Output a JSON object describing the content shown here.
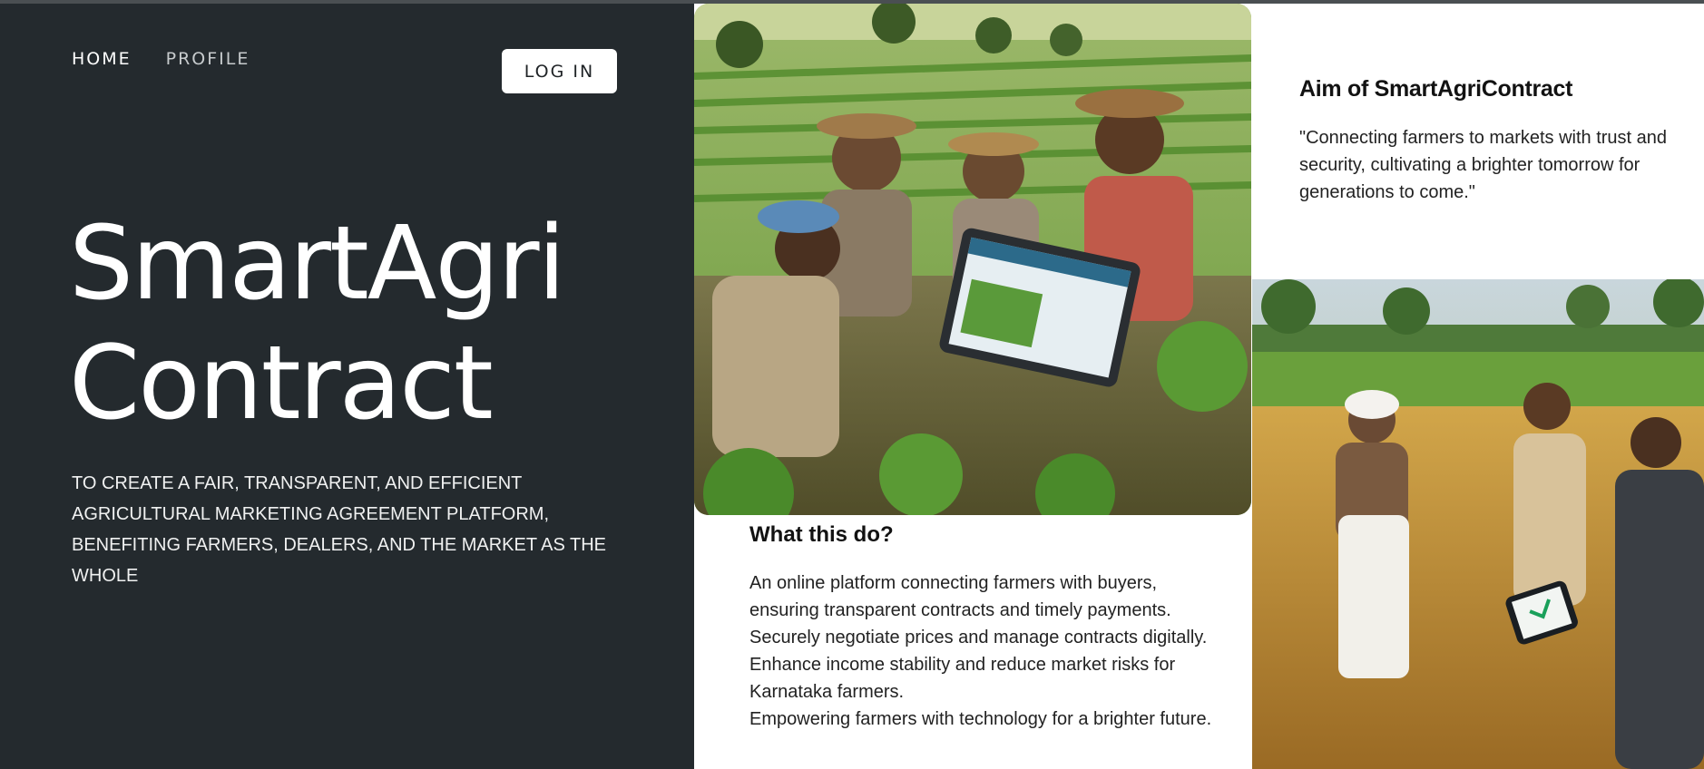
{
  "nav": {
    "items": [
      {
        "label": "HOME"
      },
      {
        "label": "PROFILE"
      }
    ],
    "login_label": "LOG IN"
  },
  "hero": {
    "title_line1": "SmartAgri",
    "title_line2": "Contract",
    "mission": "TO CREATE A FAIR, TRANSPARENT, AND EFFICIENT AGRICULTURAL MARKETING AGREEMENT PLATFORM, BENEFITING FARMERS, DEALERS, AND THE MARKET AS THE WHOLE"
  },
  "aim": {
    "heading": "Aim of SmartAgriContract",
    "quote": "\"Connecting farmers to markets with trust and security, cultivating a brighter tomorrow for generations to come.\""
  },
  "what": {
    "heading": "What this do?",
    "points": [
      "An online platform connecting farmers with buyers, ensuring transparent contracts and timely payments.",
      "Securely negotiate prices and manage contracts digitally.",
      "Enhance income stability and reduce market risks for Karnataka farmers.",
      "Empowering farmers with technology for a brighter future."
    ]
  },
  "images": {
    "farmers_tablet": "farmers-with-tablet-photo",
    "farmer_field": "farmer-dealer-field-photo"
  },
  "colors": {
    "hero_bg": "#242a2e",
    "text_dark": "#121212",
    "white": "#ffffff"
  }
}
